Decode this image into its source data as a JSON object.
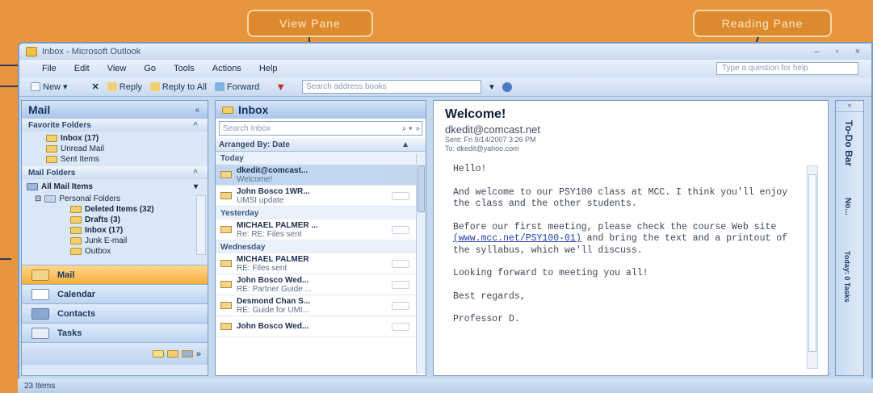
{
  "callouts": {
    "view_pane": "View Pane",
    "reading_pane": "Reading Pane"
  },
  "window": {
    "title": "Inbox - Microsoft Outlook",
    "min": "–",
    "max": "▫",
    "close": "×"
  },
  "menu": [
    "File",
    "Edit",
    "View",
    "Go",
    "Tools",
    "Actions",
    "Help"
  ],
  "help_box": {
    "placeholder": "Type a question for help"
  },
  "toolbar": {
    "new": "New",
    "reply": "Reply",
    "reply_all": "Reply to All",
    "forward": "Forward",
    "address_search": {
      "placeholder": "Search address books"
    }
  },
  "nav": {
    "title": "Mail",
    "favorites_header": "Favorite Folders",
    "favorites": [
      {
        "label": "Inbox (17)",
        "bold": true
      },
      {
        "label": "Unread Mail",
        "bold": false
      },
      {
        "label": "Sent Items",
        "bold": false
      }
    ],
    "mail_folders_header": "Mail Folders",
    "all_mail": "All Mail Items",
    "personal": "Personal Folders",
    "tree": [
      {
        "label": "Deleted Items (32)",
        "bold": true
      },
      {
        "label": "Drafts (3)",
        "bold": true
      },
      {
        "label": "Inbox (17)",
        "bold": true
      },
      {
        "label": "Junk E-mail",
        "bold": false
      },
      {
        "label": "Outbox",
        "bold": false
      }
    ],
    "buttons": [
      "Mail",
      "Calendar",
      "Contacts",
      "Tasks"
    ]
  },
  "inbox": {
    "title": "Inbox",
    "search_placeholder": "Search Inbox",
    "arranged": "Arranged By: Date",
    "groups": [
      {
        "name": "Today",
        "messages": [
          {
            "from": "dkedit@comcast...",
            "subject": "Welcome!",
            "selected": true
          },
          {
            "from": "John Bosco 1WR...",
            "subject": "UMSI update",
            "selected": false
          }
        ]
      },
      {
        "name": "Yesterday",
        "messages": [
          {
            "from": "MICHAEL PALMER ...",
            "subject": "Re: RE: Files sent",
            "selected": false
          }
        ]
      },
      {
        "name": "Wednesday",
        "messages": [
          {
            "from": "MICHAEL PALMER",
            "subject": "RE: Files sent",
            "selected": false
          },
          {
            "from": "John Bosco Wed...",
            "subject": "RE: Partner Guide ...",
            "selected": false
          },
          {
            "from": "Desmond Chan S...",
            "subject": "RE: Guide for UMI...",
            "selected": false
          },
          {
            "from": "John Bosco Wed...",
            "subject": "",
            "selected": false
          }
        ]
      }
    ]
  },
  "reading": {
    "subject": "Welcome!",
    "sender": "dkedit@comcast.net",
    "sent": "Sent:  Fri 9/14/2007 3:26 PM",
    "to": "To:    dkedit@yahoo.com",
    "body": {
      "greeting": "Hello!",
      "p1": "And welcome to our PSY100 class at MCC. I think you'll enjoy the class and the other students.",
      "p2a": "Before our first meeting, please check the course Web site",
      "link": "(www.mcc.net/PSY100-01)",
      "p2b": " and bring the text and a printout of the syllabus, which we'll discuss.",
      "p3": "Looking forward to meeting you all!",
      "p4": "Best regards,",
      "p5": "Professor D."
    }
  },
  "todo": {
    "title": "To-Do Bar",
    "no_appointments": "No...",
    "tasks": "Today: 0 Tasks"
  },
  "status": "23 Items"
}
